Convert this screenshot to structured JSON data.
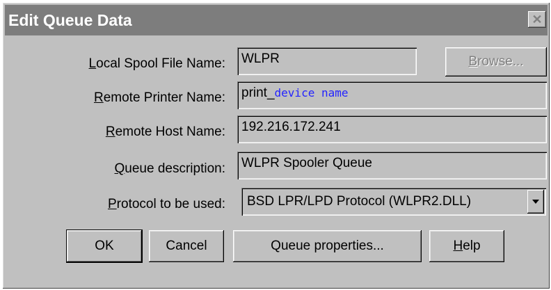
{
  "window": {
    "title": "Edit Queue Data",
    "close_glyph": "✕"
  },
  "fields": {
    "local_spool": {
      "label_key": "L",
      "label_rest": "ocal Spool File Name:",
      "value": "WLPR"
    },
    "remote_printer": {
      "label_key": "R",
      "label_rest": "emote Printer Name:",
      "value_prefix": "print_",
      "value_placeholder": "device name"
    },
    "remote_host": {
      "label_key": "R",
      "label_rest": "emote Host Name:",
      "value": "192.216.172.241"
    },
    "queue_desc": {
      "label_key": "Q",
      "label_rest": "ueue description:",
      "value": "WLPR Spooler Queue"
    },
    "protocol": {
      "label_key": "P",
      "label_rest": "rotocol to be used:",
      "value": "BSD LPR/LPD Protocol (WLPR2.DLL)"
    }
  },
  "buttons": {
    "browse": {
      "key": "B",
      "rest": "rowse..."
    },
    "ok": {
      "label": "OK"
    },
    "cancel": {
      "label": "Cancel"
    },
    "queue_props": {
      "label": "Queue properties..."
    },
    "help": {
      "key": "H",
      "rest": "elp"
    }
  },
  "colors": {
    "title_bar": "#7d7d7d",
    "dialog_face": "#c0c0c0",
    "placeholder_text": "#2323ff"
  }
}
